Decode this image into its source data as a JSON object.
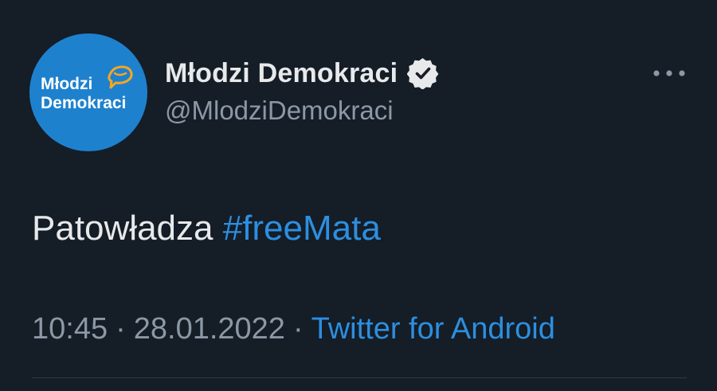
{
  "tweet": {
    "avatar": {
      "logo_line1": "Młodzi",
      "logo_line2": "Demokraci",
      "brand_color": "#1e81ce",
      "logo_accent_color": "#f5a623"
    },
    "display_name": "Młodzi Demokraci",
    "verified": true,
    "handle": "@MlodziDemokraci",
    "more_icon": "more-horizontal-icon",
    "text": {
      "plain": "Patowładza ",
      "hashtag": "#freeMata"
    },
    "meta": {
      "time": "10:45",
      "separator": "·",
      "date": "28.01.2022",
      "source": "Twitter for Android"
    }
  },
  "colors": {
    "background": "#151d27",
    "primary_text": "#e7e9ea",
    "secondary_text": "#8b98a5",
    "link": "#2c8fe0",
    "divider": "#2f3a46"
  }
}
